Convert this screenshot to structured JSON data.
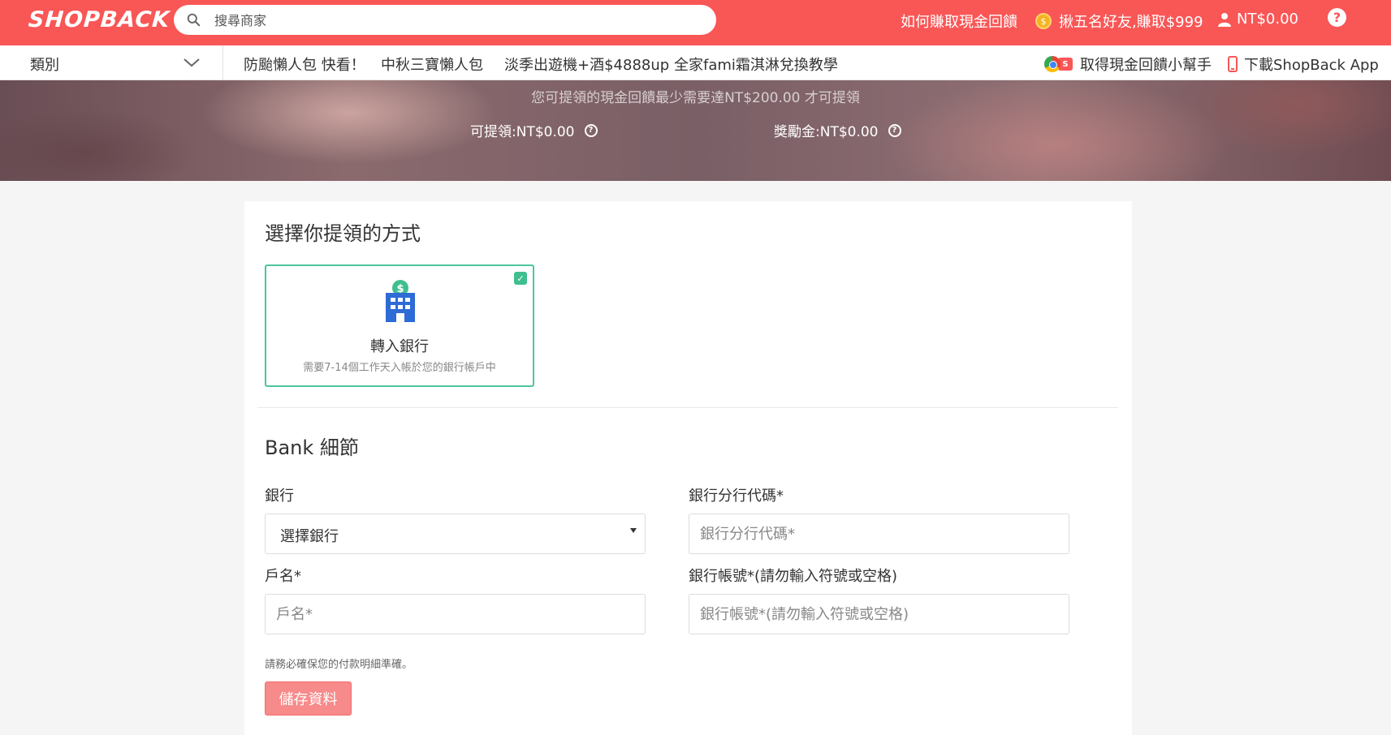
{
  "header": {
    "logo": "SHOPBACK",
    "search_placeholder": "搜尋商家",
    "how_to_earn": "如何賺取現金回饋",
    "referral": "揪五名好友,賺取$999",
    "balance": "NT$0.00",
    "help": "?"
  },
  "nav": {
    "category": "類別",
    "items": [
      "防颱懶人包 快看！",
      "中秋三寶懶人包",
      "淡季出遊機+酒$4888up",
      "全家fami霜淇淋兌換教學"
    ],
    "extension": "取得現金回饋小幫手",
    "app": "下載ShopBack App"
  },
  "banner": {
    "note": "您可提領的現金回饋最少需要達NT$200.00 才可提領",
    "withdrawable": "可提領:NT$0.00",
    "bonus": "獎勵金:NT$0.00"
  },
  "withdraw": {
    "title": "選擇你提領的方式",
    "option_title": "轉入銀行",
    "option_desc": "需要7-14個工作天入帳於您的銀行帳戶中",
    "option_selected": true
  },
  "bank": {
    "title": "Bank 細節",
    "bank_label": "銀行",
    "bank_value": "選擇銀行",
    "branch_label": "銀行分行代碼*",
    "branch_placeholder": "銀行分行代碼*",
    "name_label": "戶名*",
    "name_placeholder": "戶名*",
    "account_label": "銀行帳號*(請勿輸入符號或空格)",
    "account_placeholder": "銀行帳號*(請勿輸入符號或空格)",
    "hint": "請務必確保您的付款明細準確。",
    "save": "儲存資料"
  },
  "colors": {
    "brand": "#f95656",
    "selected_border": "#4cc79a",
    "save_button": "#f78a8a"
  }
}
